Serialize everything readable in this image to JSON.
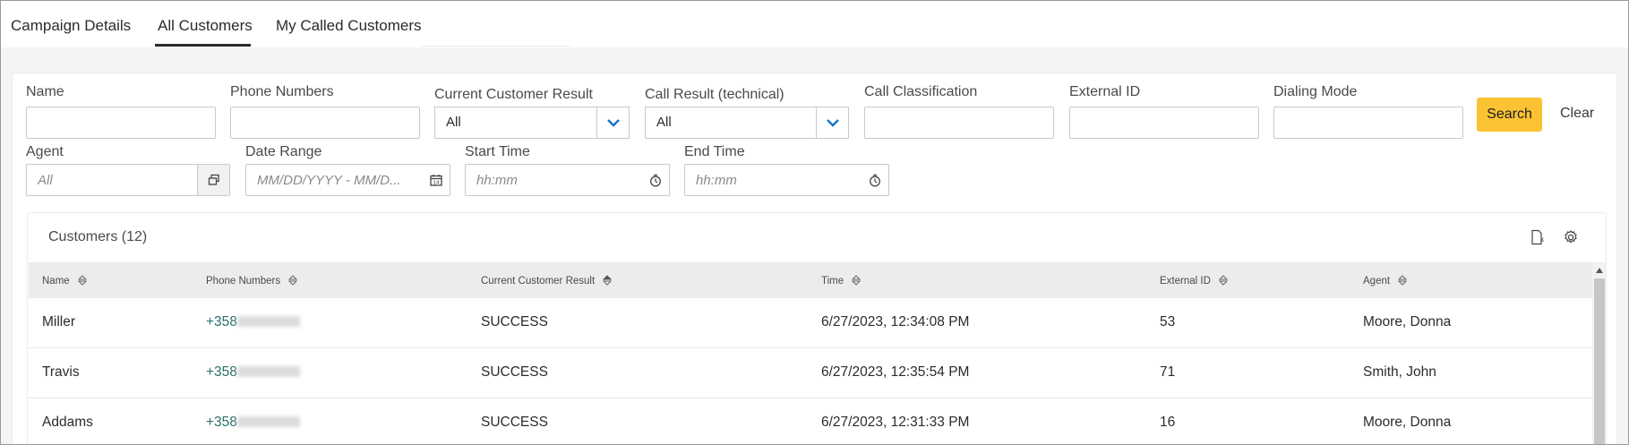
{
  "tabs": [
    {
      "label": "Campaign Details",
      "active": false
    },
    {
      "label": "All Customers",
      "active": true
    },
    {
      "label": "My Called Customers",
      "active": false
    }
  ],
  "filters": {
    "name": {
      "label": "Name",
      "value": ""
    },
    "phone_numbers": {
      "label": "Phone Numbers",
      "value": ""
    },
    "current_customer_result": {
      "label": "Current Customer Result",
      "value": "All"
    },
    "call_result": {
      "label": "Call Result (technical)",
      "value": "All"
    },
    "call_classification": {
      "label": "Call Classification",
      "value": ""
    },
    "external_id": {
      "label": "External ID",
      "value": ""
    },
    "dialing_mode": {
      "label": "Dialing Mode",
      "value": ""
    },
    "agent": {
      "label": "Agent",
      "placeholder": "All"
    },
    "date_range": {
      "label": "Date Range",
      "placeholder": "MM/DD/YYYY - MM/D..."
    },
    "start_time": {
      "label": "Start Time",
      "placeholder": "hh:mm"
    },
    "end_time": {
      "label": "End Time",
      "placeholder": "hh:mm"
    },
    "search_label": "Search",
    "clear_label": "Clear"
  },
  "customers": {
    "title": "Customers (12)",
    "columns": [
      "Name",
      "Phone Numbers",
      "Current Customer Result",
      "Time",
      "External ID",
      "Agent"
    ],
    "rows": [
      {
        "name": "Miller",
        "phone": "+358",
        "result": "SUCCESS",
        "time": "6/27/2023, 12:34:08 PM",
        "external_id": "53",
        "agent": "Moore, Donna"
      },
      {
        "name": "Travis",
        "phone": "+358",
        "result": "SUCCESS",
        "time": "6/27/2023, 12:35:54 PM",
        "external_id": "71",
        "agent": "Smith, John"
      },
      {
        "name": "Addams",
        "phone": "+358",
        "result": "SUCCESS",
        "time": "6/27/2023, 12:31:33 PM",
        "external_id": "16",
        "agent": "Moore, Donna"
      }
    ]
  },
  "colors": {
    "accent_button": "#fbc233",
    "phone_link": "#2a6f6c",
    "caret": "#1a73c9"
  },
  "icons": [
    "chevron-down-icon",
    "open-window-icon",
    "calendar-icon",
    "clock-icon",
    "export-excel-icon",
    "gear-icon",
    "sort-icon"
  ]
}
